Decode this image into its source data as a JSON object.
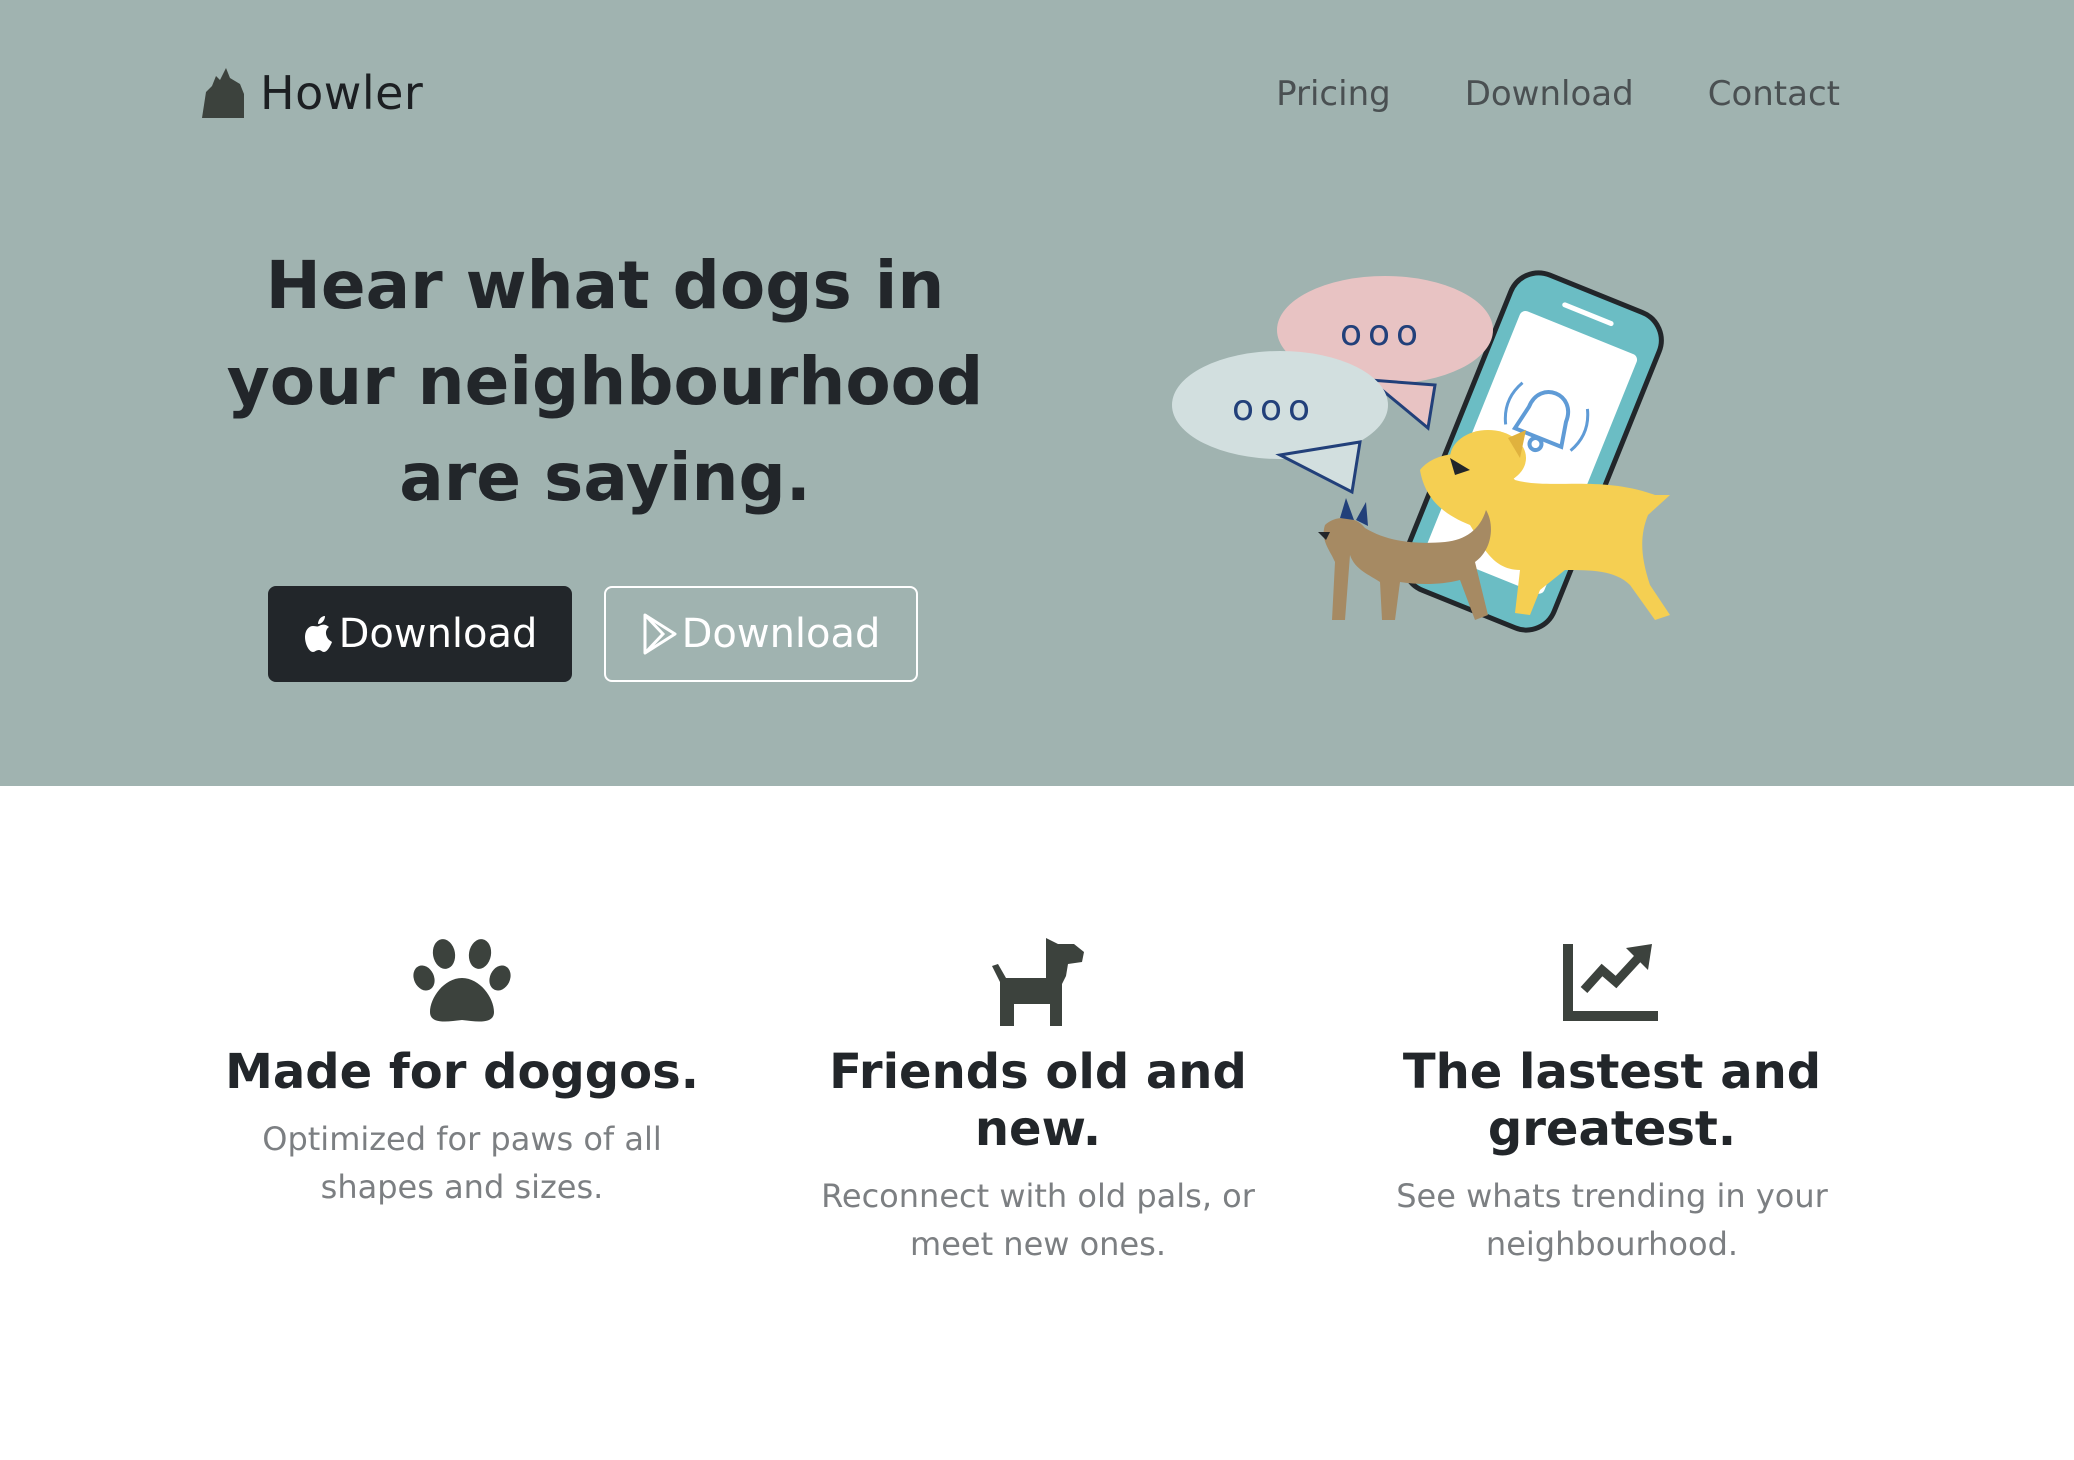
{
  "brand": {
    "name": "Howler",
    "logo_icon": "howling-wolf-icon"
  },
  "nav": {
    "links": [
      "Pricing",
      "Download",
      "Contact"
    ]
  },
  "hero": {
    "headline": "Hear what dogs in your neighbourhood are saying.",
    "buttons": [
      {
        "label": "Download",
        "icon": "apple-icon",
        "style": "dark"
      },
      {
        "label": "Download",
        "icon": "google-play-icon",
        "style": "outline"
      }
    ],
    "illustration": "dogs-with-phone-and-speech-bubbles-illustration"
  },
  "features": [
    {
      "icon": "paw-icon",
      "title": "Made for doggos.",
      "text": "Optimized for paws of all shapes and sizes."
    },
    {
      "icon": "dog-icon",
      "title": "Friends old and new.",
      "text": "Reconnect with old pals, or meet new ones."
    },
    {
      "icon": "trending-chart-icon",
      "title": "The lastest and greatest.",
      "text": "See whats trending in your neighbourhood."
    }
  ],
  "colors": {
    "hero_background": "#a0b3b0",
    "text_dark": "#22262a",
    "text_muted": "#7c7f82",
    "icon_dark": "#3c423d",
    "bubble_pink": "#e8c3c3",
    "bubble_blue": "#d2dfdf",
    "phone_teal": "#6bbdc4",
    "dog_yellow": "#f5cf52",
    "dog_brown": "#a68a63"
  }
}
